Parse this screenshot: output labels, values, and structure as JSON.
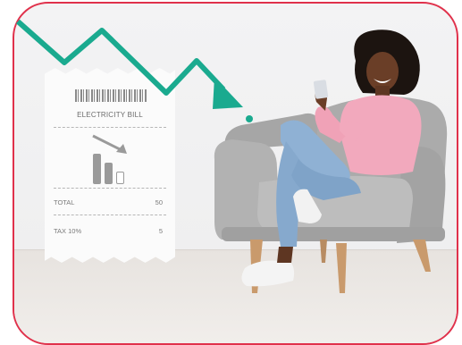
{
  "receipt": {
    "title": "ELECTRICITY BILL",
    "rows": [
      {
        "label": "TOTAL",
        "value": "50"
      },
      {
        "label": "TAX 10%",
        "value": "5"
      }
    ]
  },
  "colors": {
    "frame_border": "#e0314b",
    "trend_arrow": "#1aaa8f",
    "hoodie": "#f2a9bd",
    "jeans": "#8fb1d4",
    "chair": "#a9a9a9"
  },
  "icons": [
    "bar-chart-down-icon",
    "trend-down-arrow-icon"
  ]
}
